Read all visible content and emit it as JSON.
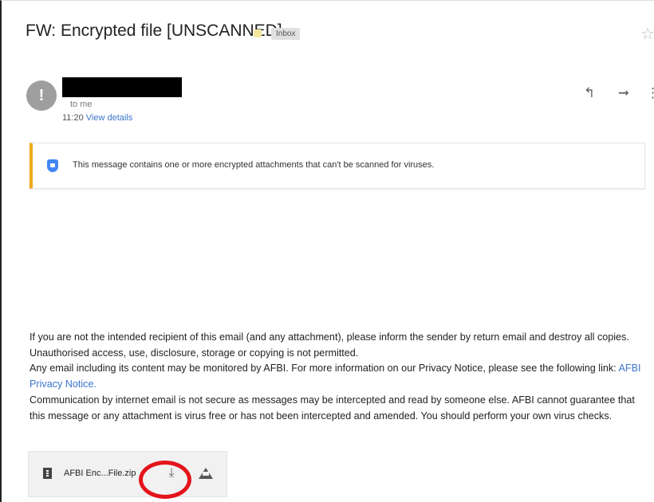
{
  "email": {
    "subject": "FW: Encrypted file [UNSCANNED]",
    "label": "Inbox",
    "avatar_glyph": "!",
    "to": "to me",
    "time": "11:20",
    "view_details": "View details"
  },
  "banner": {
    "text": "This message contains one or more encrypted attachments that can't be scanned for viruses."
  },
  "body": {
    "p1": "If you are not the intended recipient of this email (and any attachment), please inform the sender by return email and destroy all copies. Unauthorised access, use, disclosure, storage or copying is not permitted.",
    "p2": "Any email including its content may be monitored by AFBI. For more information on our Privacy Notice, please see the following link:",
    "privacy_link": "AFBI Privacy Notice.",
    "p3": "Communication by internet email is not secure as messages may be intercepted and read by someone else. AFBI cannot guarantee that this message or any attachment is virus free or has not been intercepted and amended. You should perform your own virus checks."
  },
  "attachment": {
    "name": "AFBI Enc...File.zip"
  },
  "icons": {
    "reply": "reply-icon",
    "forward": "forward-icon",
    "more": "more-vert-icon",
    "star": "star-icon",
    "shield": "shield-icon",
    "zip": "zip-file-icon",
    "download": "download-icon",
    "drive": "drive-icon"
  },
  "colors": {
    "banner_accent": "#f0a81c",
    "link": "#3b74cc",
    "highlight_circle": "#e4141b"
  }
}
